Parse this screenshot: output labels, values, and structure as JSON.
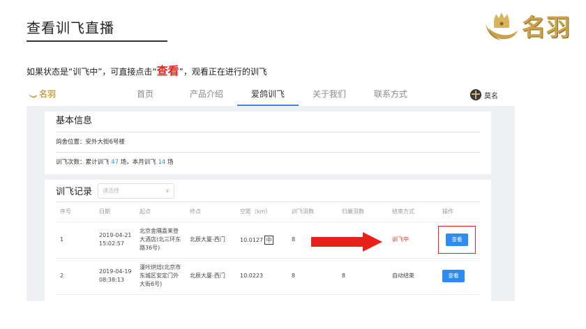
{
  "slide": {
    "title": "查看训飞直播",
    "instruction_pre": "如果状态是“训飞中”，可直接点击“",
    "instruction_kw": "查看",
    "instruction_post": "”，观看正在进行的训飞"
  },
  "brand": {
    "name": "名羽",
    "colors": {
      "gold": "#c9a24a"
    }
  },
  "nav": {
    "logo": "名羽",
    "items": [
      "首页",
      "产品介绍",
      "爱鸽训飞",
      "关于我们",
      "联系方式"
    ],
    "active_index": 2,
    "user": "莫名"
  },
  "basic_info": {
    "title": "基本信息",
    "location_label": "鸽舍位置：",
    "location": "安外大街6号楼",
    "count_label": "训飞次数：累计训飞 ",
    "total": "47",
    "mid_text": " 场，本月训飞 ",
    "month": "14",
    "suffix": " 场"
  },
  "records": {
    "title": "训飞记录",
    "select_placeholder": "请选择",
    "columns": [
      "序号",
      "日期",
      "起点",
      "终点",
      "空距（km）",
      "训飞羽数",
      "归巢羽数",
      "结束方式",
      "操作"
    ],
    "rows": [
      {
        "index": "1",
        "date": "2019-04-21",
        "time": "15:02:57",
        "start_1": "北京金隅喜来登",
        "start_2": "大酒店(北三环东",
        "start_3": "路36号)",
        "end": "北辰大厦-西门",
        "distance": "10.0127",
        "ime": "中",
        "flown": "8",
        "returned": "",
        "status": "训飞中",
        "action": "查看"
      },
      {
        "index": "2",
        "date": "2019-04-19",
        "time": "08:38:13",
        "start_1": "漫咔烘焙(北京市",
        "start_2": "东城区安定门外",
        "start_3": "大街6号)",
        "end": "北辰大厦-西门",
        "distance": "10.0223",
        "flown": "8",
        "returned": "8",
        "status": "自动结束",
        "action": "查看"
      }
    ]
  },
  "colors": {
    "accent": "#2d8cf0",
    "highlight": "#e8221b"
  },
  "icons": {
    "arrow": "right-arrow-icon",
    "emblem": "crown-emblem-icon"
  }
}
